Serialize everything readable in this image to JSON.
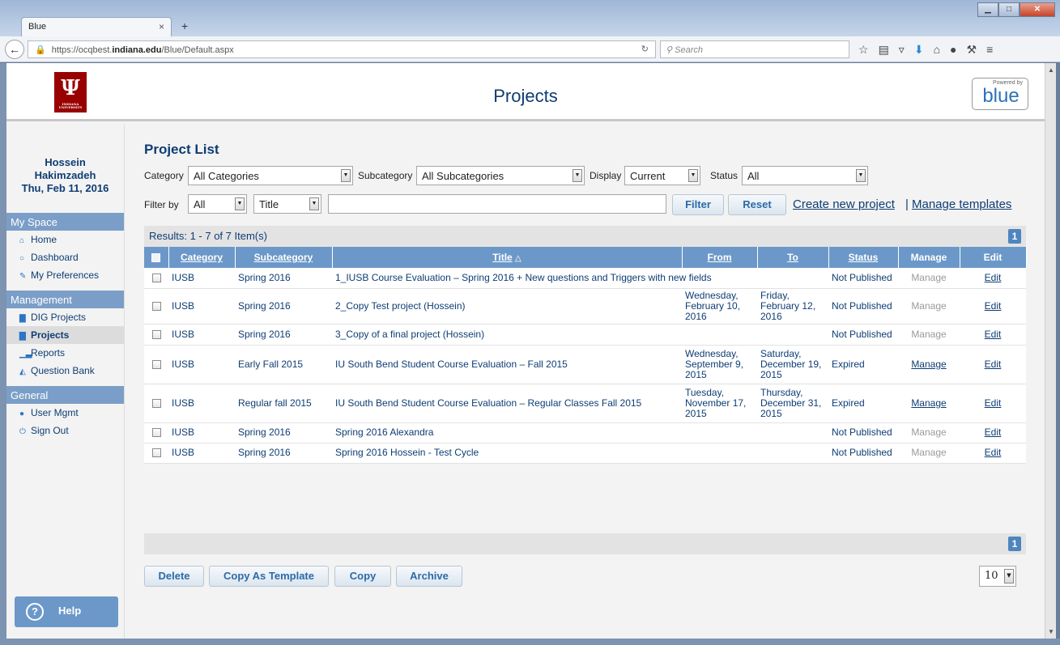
{
  "browser": {
    "tab_title": "Blue",
    "tab_close": "×",
    "new_tab": "+",
    "url_prefix": "https://ocqbest.",
    "url_domain": "indiana.edu",
    "url_path": "/Blue/Default.aspx",
    "search_placeholder": "Search"
  },
  "header": {
    "page_title": "Projects",
    "logo_letter": "Ψ",
    "logo_caption": "INDIANA UNIVERSITY",
    "powered_by": "Powered by",
    "powered_brand": "blue"
  },
  "user": {
    "first_name": "Hossein",
    "last_name": "Hakimzadeh",
    "date": "Thu, Feb 11, 2016"
  },
  "sidebar": {
    "my_space": "My Space",
    "home": "Home",
    "dashboard": "Dashboard",
    "preferences": "My Preferences",
    "management": "Management",
    "dig_projects": "DIG Projects",
    "projects": "Projects",
    "reports": "Reports",
    "question_bank": "Question Bank",
    "general": "General",
    "user_mgmt": "User Mgmt",
    "sign_out": "Sign Out",
    "help": "Help"
  },
  "list": {
    "title": "Project List",
    "category_label": "Category",
    "category_value": "All Categories",
    "subcategory_label": "Subcategory",
    "subcategory_value": "All Subcategories",
    "display_label": "Display",
    "display_value": "Current",
    "status_label": "Status",
    "status_value": "All",
    "filterby_label": "Filter by",
    "filterby_value": "All",
    "filterfield_value": "Title",
    "filter_text": "",
    "filter_button": "Filter",
    "reset_button": "Reset",
    "create_link": "Create new project",
    "separator": "|",
    "templates_link": "Manage templates",
    "results": "Results: 1 - 7 of 7 Item(s)",
    "page": "1"
  },
  "columns": {
    "category": "Category",
    "subcategory": "Subcategory",
    "title": "Title",
    "from": "From",
    "to": "To",
    "status": "Status",
    "manage": "Manage",
    "edit": "Edit"
  },
  "rows": [
    {
      "category": "IUSB",
      "subcategory": "Spring 2016",
      "title": "1_IUSB Course Evaluation – Spring 2016 + New questions and Triggers with new fields",
      "from": "",
      "to": "",
      "status": "Not Published",
      "manage": "Manage",
      "edit": "Edit"
    },
    {
      "category": "IUSB",
      "subcategory": "Spring 2016",
      "title": "2_Copy Test project (Hossein)",
      "from": "Wednesday, February 10, 2016",
      "to": "Friday, February 12, 2016",
      "status": "Not Published",
      "manage": "Manage",
      "edit": "Edit"
    },
    {
      "category": "IUSB",
      "subcategory": "Spring 2016",
      "title": "3_Copy of a final project (Hossein)",
      "from": "",
      "to": "",
      "status": "Not Published",
      "manage": "Manage",
      "edit": "Edit"
    },
    {
      "category": "IUSB",
      "subcategory": "Early Fall 2015",
      "title": "IU South Bend Student Course Evaluation – Fall 2015",
      "from": "Wednesday, September 9, 2015",
      "to": "Saturday, December 19, 2015",
      "status": "Expired",
      "manage": "Manage",
      "edit": "Edit"
    },
    {
      "category": "IUSB",
      "subcategory": "Regular fall 2015",
      "title": "IU South Bend Student Course Evaluation – Regular Classes Fall 2015",
      "from": "Tuesday, November 17, 2015",
      "to": "Thursday, December 31, 2015",
      "status": "Expired",
      "manage": "Manage",
      "edit": "Edit"
    },
    {
      "category": "IUSB",
      "subcategory": "Spring 2016",
      "title": "Spring 2016 Alexandra",
      "from": "",
      "to": "",
      "status": "Not Published",
      "manage": "Manage",
      "edit": "Edit"
    },
    {
      "category": "IUSB",
      "subcategory": "Spring 2016",
      "title": "Spring 2016 Hossein - Test Cycle",
      "from": "",
      "to": "",
      "status": "Not Published",
      "manage": "Manage",
      "edit": "Edit"
    }
  ],
  "actions": {
    "delete": "Delete",
    "copy_template": "Copy As Template",
    "copy": "Copy",
    "archive": "Archive",
    "page_size": "10"
  }
}
